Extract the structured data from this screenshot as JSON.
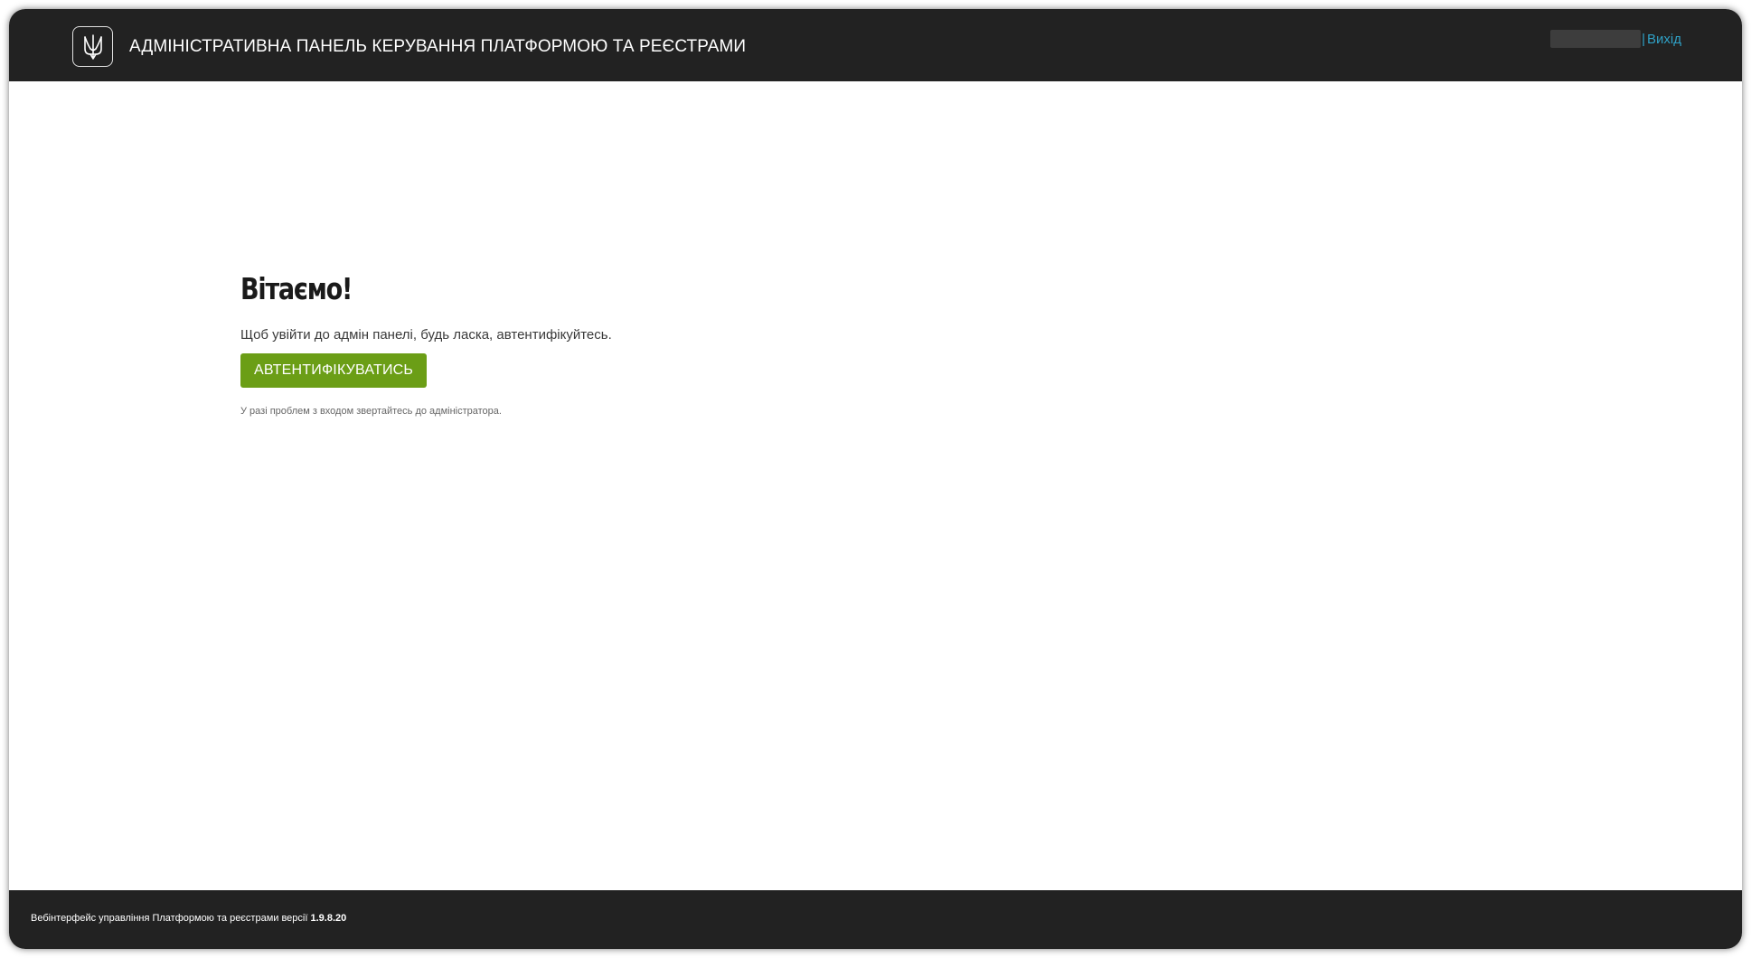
{
  "header": {
    "title": "АДМІНІСТРАТИВНА ПАНЕЛЬ КЕРУВАННЯ ПЛАТФОРМОЮ ТА РЕЄСТРАМИ",
    "logo_icon": "trident-icon",
    "divider": "|",
    "logout_label": "Вихід"
  },
  "main": {
    "heading": "Вітаємо!",
    "description": "Щоб увійти до адмін панелі, будь ласка, автентифікуйтесь.",
    "auth_button_label": "АВТЕНТИФІКУВАТИСЬ",
    "help_text": "У разі проблем з входом звертайтесь до адміністратора."
  },
  "footer": {
    "text": "Вебінтерфейс управління Платформою та реєстрами версії",
    "version": "1.9.8.20"
  },
  "colors": {
    "bar_background": "#222222",
    "accent_green": "#6b9e16",
    "link_blue": "#2fa0c5"
  }
}
